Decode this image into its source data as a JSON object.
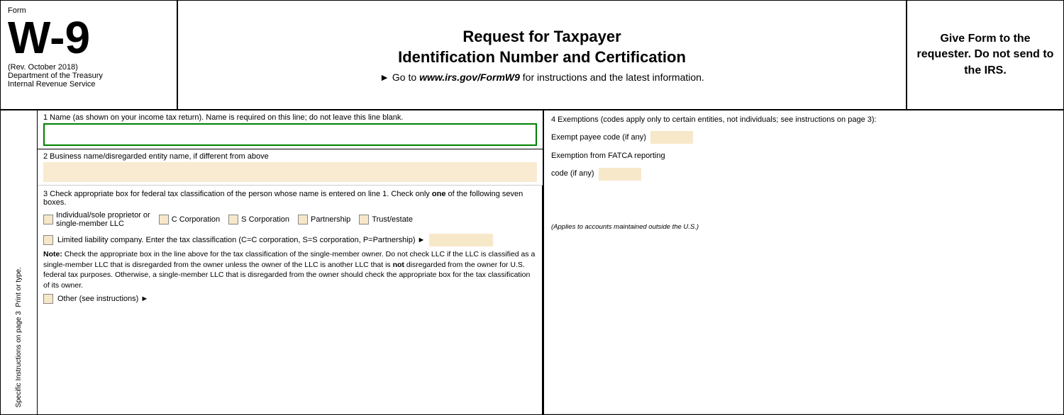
{
  "header": {
    "form_label": "Form",
    "form_number": "W-9",
    "rev_date": "(Rev. October 2018)",
    "dept1": "Department of the Treasury",
    "dept2": "Internal Revenue Service",
    "main_title_line1": "Request for Taxpayer",
    "main_title_line2": "Identification Number and Certification",
    "subtitle_prefix": "► Go to ",
    "subtitle_url": "www.irs.gov/FormW9",
    "subtitle_suffix": " for instructions and the latest information.",
    "give_form": "Give Form to the requester. Do not send to the IRS."
  },
  "fields": {
    "field1_label": "1  Name (as shown on your income tax return). Name is required on this line; do not leave this line blank.",
    "field2_label": "2  Business name/disregarded entity name, if different from above"
  },
  "section3": {
    "title": "3  Check appropriate box for federal tax classification of the person whose name is entered on line 1. Check only ",
    "title_bold": "one",
    "title_end": " of the following seven boxes.",
    "checkboxes": [
      {
        "id": "indiv",
        "label": "Individual/sole proprietor or\nsingle-member LLC"
      },
      {
        "id": "ccorp",
        "label": "C Corporation"
      },
      {
        "id": "scorp",
        "label": "S Corporation"
      },
      {
        "id": "partner",
        "label": "Partnership"
      },
      {
        "id": "trust",
        "label": "Trust/estate"
      }
    ],
    "llc_label": "Limited liability company. Enter the tax classification (C=C corporation, S=S corporation, P=Partnership) ►",
    "note_bold": "Note:",
    "note_text": " Check the appropriate box in the line above for the tax classification of the single-member owner.  Do not check LLC if the LLC is classified as a single-member LLC that is disregarded from the owner unless the owner of the LLC is another LLC that is ",
    "note_not": "not",
    "note_text2": " disregarded from the owner for U.S. federal tax purposes. Otherwise, a single-member LLC that is disregarded from the owner should check the appropriate box for the tax classification of its owner.",
    "other_label": "Other (see instructions) ►"
  },
  "section4": {
    "title": "4  Exemptions (codes apply only to certain entities, not individuals; see instructions on page 3):",
    "exempt_label": "Exempt payee code (if any)",
    "fatca_label": "Exemption from FATCA reporting",
    "fatca_label2": "code (if any)",
    "applies_note": "(Applies to accounts maintained outside the U.S.)"
  },
  "sidebar": {
    "line1": "Print or type.",
    "line2": "Specific Instructions on page 3"
  }
}
